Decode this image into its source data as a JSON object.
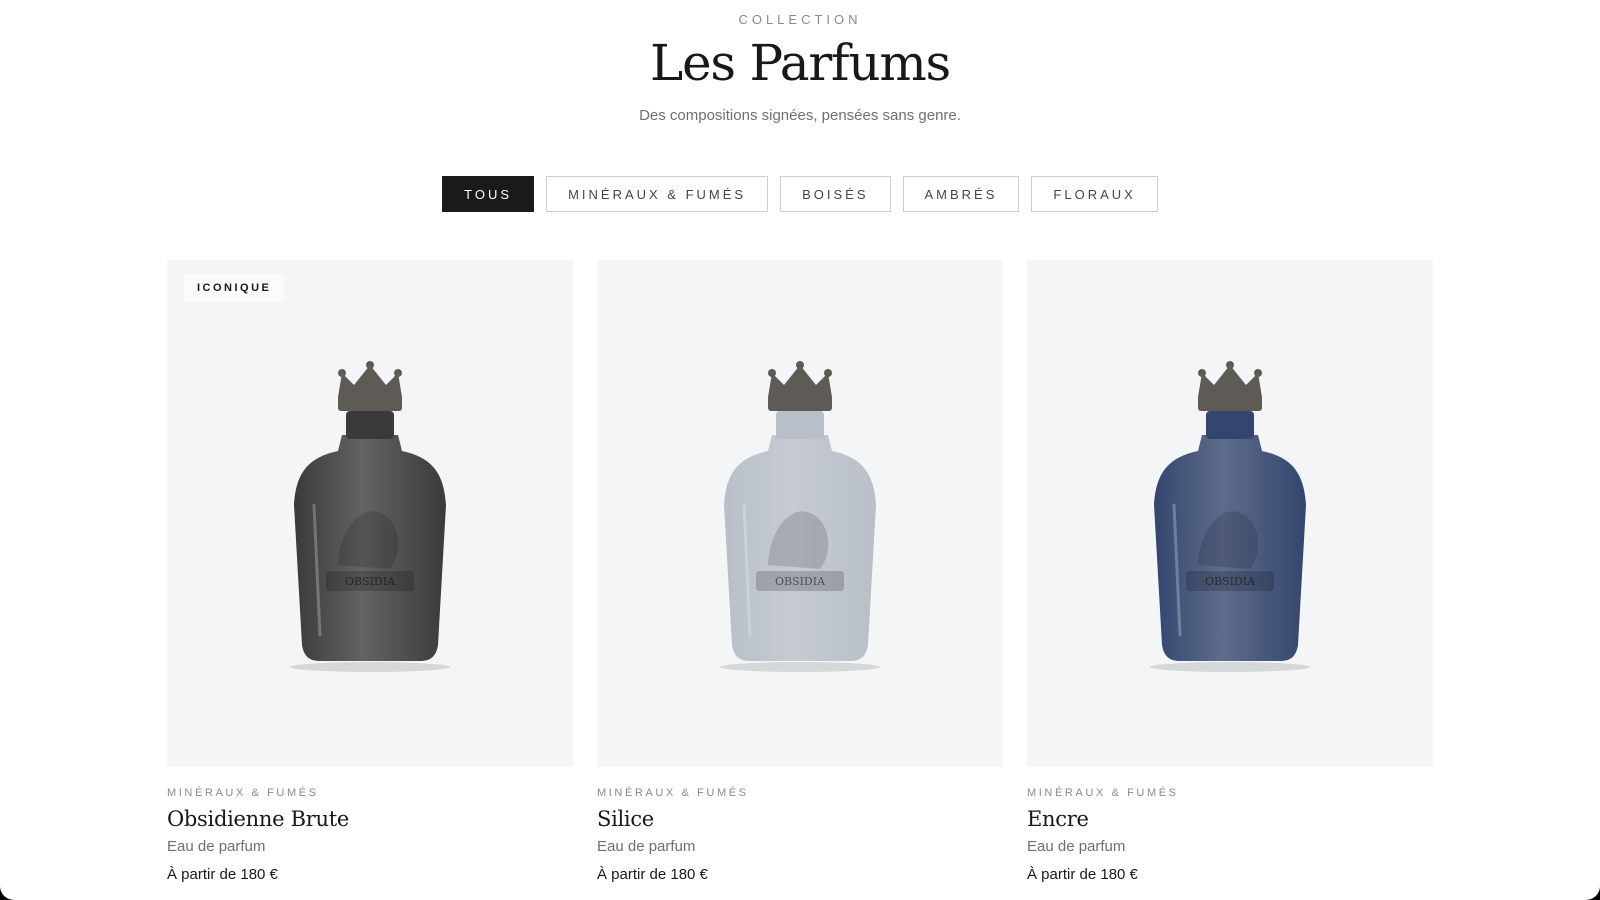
{
  "header": {
    "eyebrow": "COLLECTION",
    "title": "Les Parfums",
    "subtitle": "Des compositions signées, pensées sans genre."
  },
  "filters": [
    {
      "label": "TOUS",
      "active": true
    },
    {
      "label": "MINÉRAUX & FUMÉS",
      "active": false
    },
    {
      "label": "BOISÉS",
      "active": false
    },
    {
      "label": "AMBRÉS",
      "active": false
    },
    {
      "label": "FLORAUX",
      "active": false
    }
  ],
  "products": [
    {
      "badge": "ICONIQUE",
      "category": "MINÉRAUX & FUMÉS",
      "name": "Obsidienne Brute",
      "type": "Eau de parfum",
      "price": "À partir de 180 €",
      "bottle_label": "OBSIDIA",
      "bottle_color": "#3a3a3c"
    },
    {
      "badge": "",
      "category": "MINÉRAUX & FUMÉS",
      "name": "Silice",
      "type": "Eau de parfum",
      "price": "À partir de 180 €",
      "bottle_label": "OBSIDIA",
      "bottle_color": "#b9bfc8"
    },
    {
      "badge": "",
      "category": "MINÉRAUX & FUMÉS",
      "name": "Encre",
      "type": "Eau de parfum",
      "price": "À partir de 180 €",
      "bottle_label": "OBSIDIA",
      "bottle_color": "#34466e"
    }
  ],
  "colors": {
    "ink": "#1b1a18",
    "muted": "#8a8a8a",
    "card_bg": "#f4f5f6",
    "crown": "#5e5a55"
  }
}
